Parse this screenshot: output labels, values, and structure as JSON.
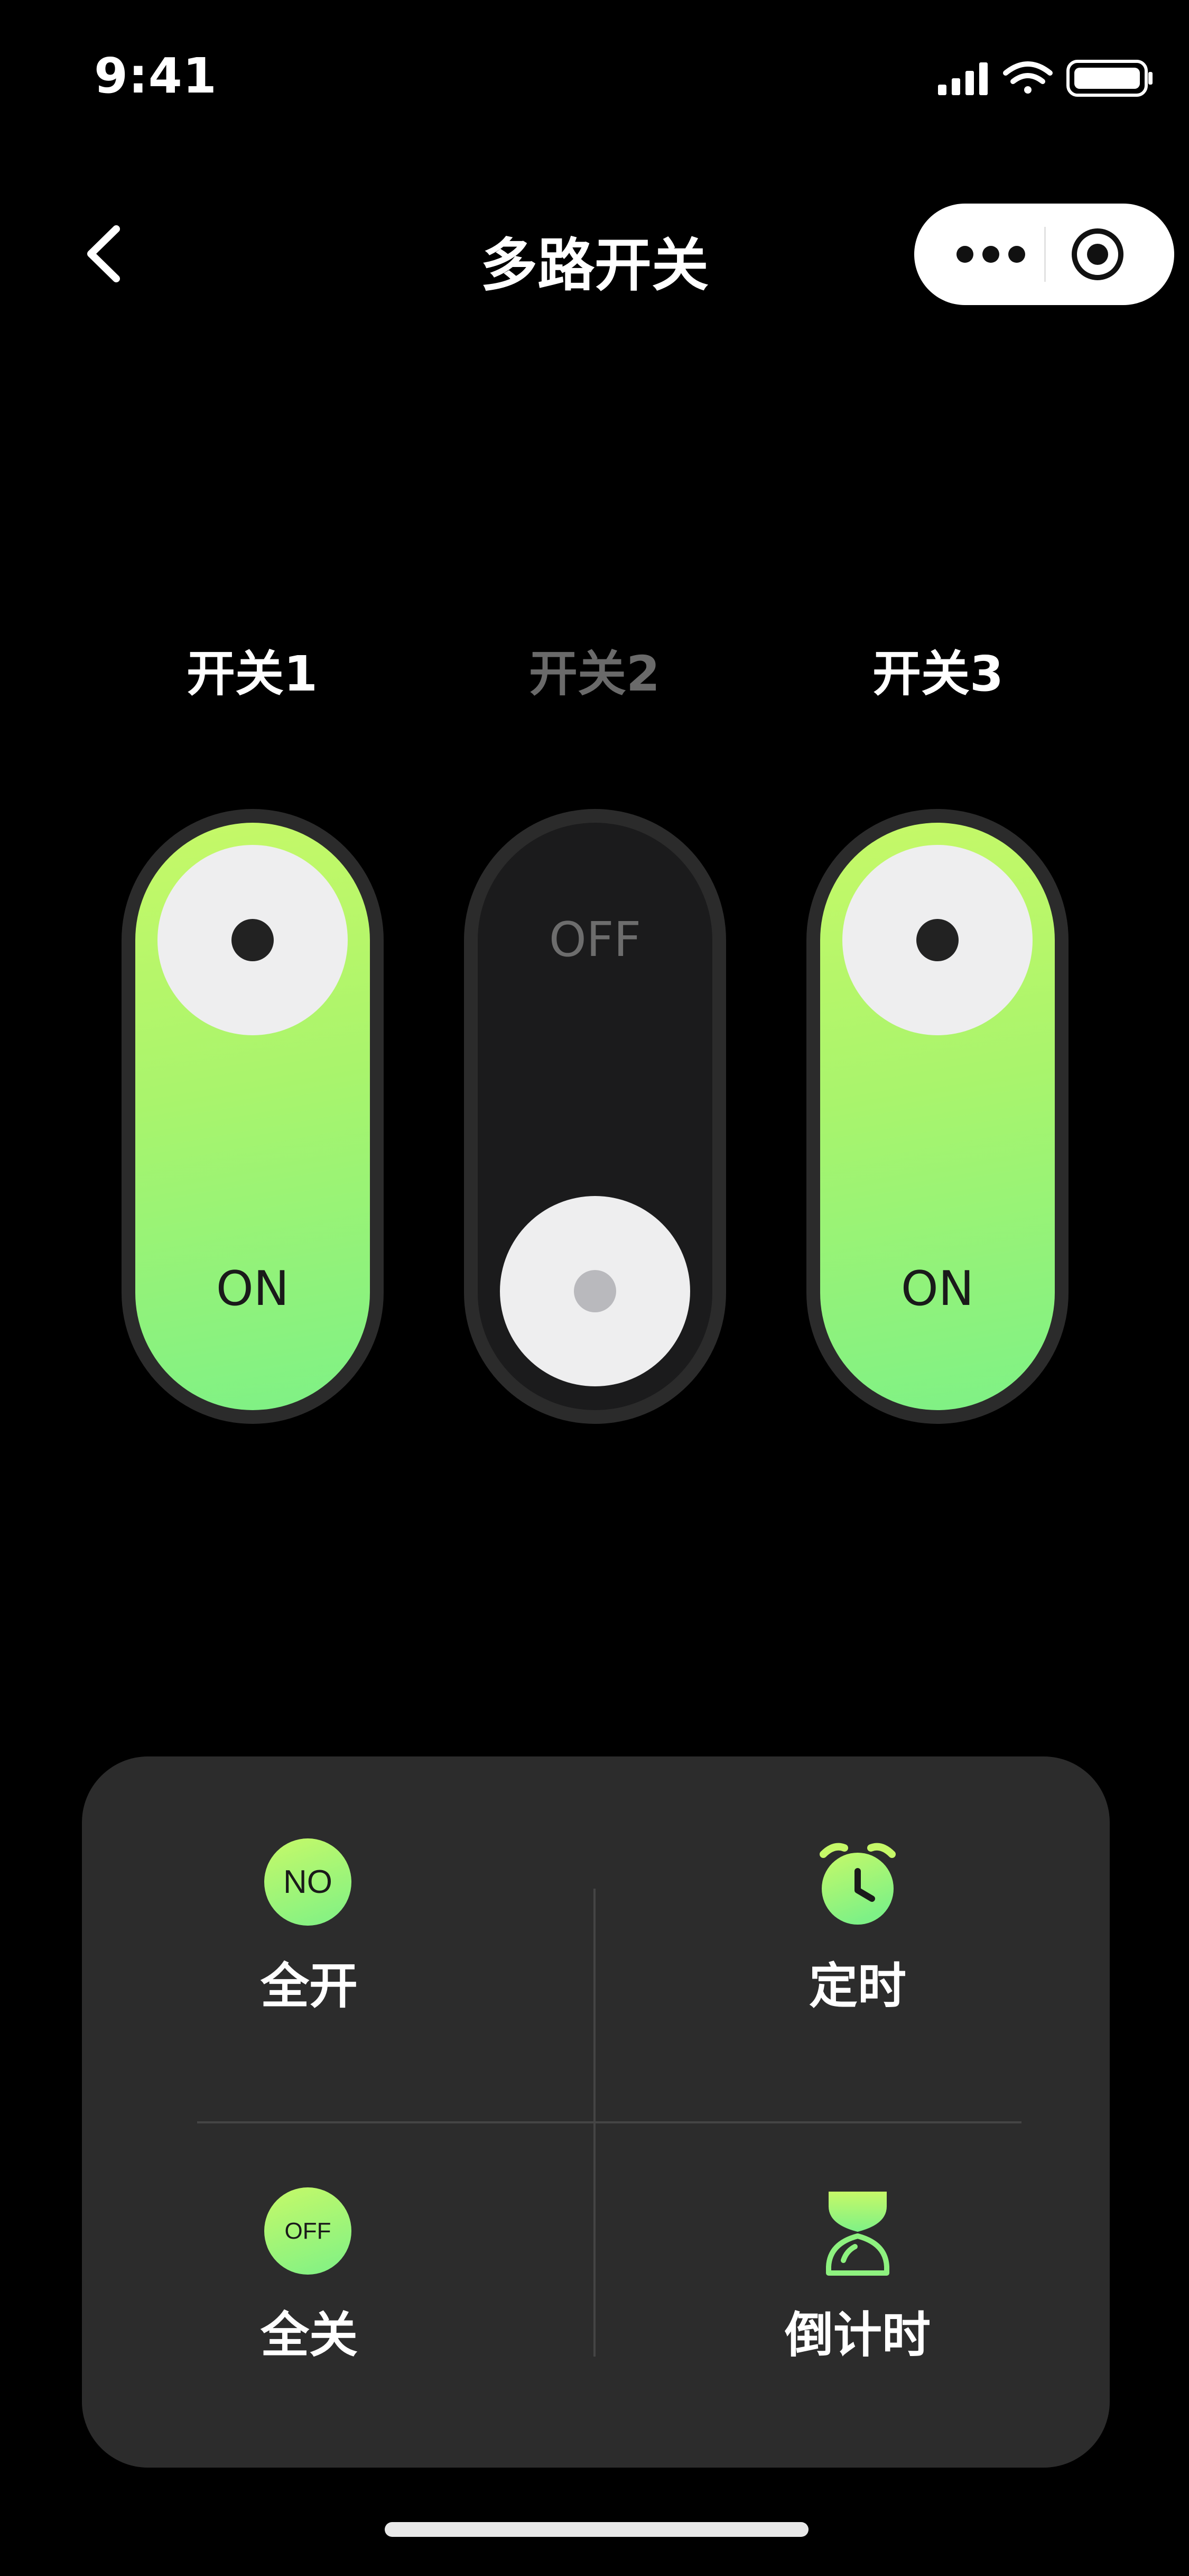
{
  "status_bar": {
    "time": "9:41",
    "icons": [
      "signal-icon",
      "wifi-icon",
      "battery-icon"
    ]
  },
  "nav": {
    "back_icon": "chevron-left-icon",
    "title": "多路开关",
    "capsule_icons": [
      "more-dots-icon",
      "target-circle-icon"
    ]
  },
  "switches": [
    {
      "label": "开关1",
      "state": "ON"
    },
    {
      "label": "开关2",
      "state": "OFF"
    },
    {
      "label": "开关3",
      "state": "ON"
    }
  ],
  "actions": [
    {
      "badge": "NO",
      "label": "全开",
      "icon": "all-on-icon"
    },
    {
      "label": "定时",
      "icon": "alarm-clock-icon"
    },
    {
      "badge": "OFF",
      "label": "全关",
      "icon": "all-off-icon"
    },
    {
      "label": "倒计时",
      "icon": "hourglass-icon"
    }
  ],
  "colors": {
    "background": "#000000",
    "accent_start": "#c6f968",
    "accent_end": "#7ef186",
    "panel": "#2c2c2c",
    "toggle_track": "#2b2b2b",
    "toggle_off": "#1b1b1c",
    "label_off": "#6a6a6a"
  }
}
